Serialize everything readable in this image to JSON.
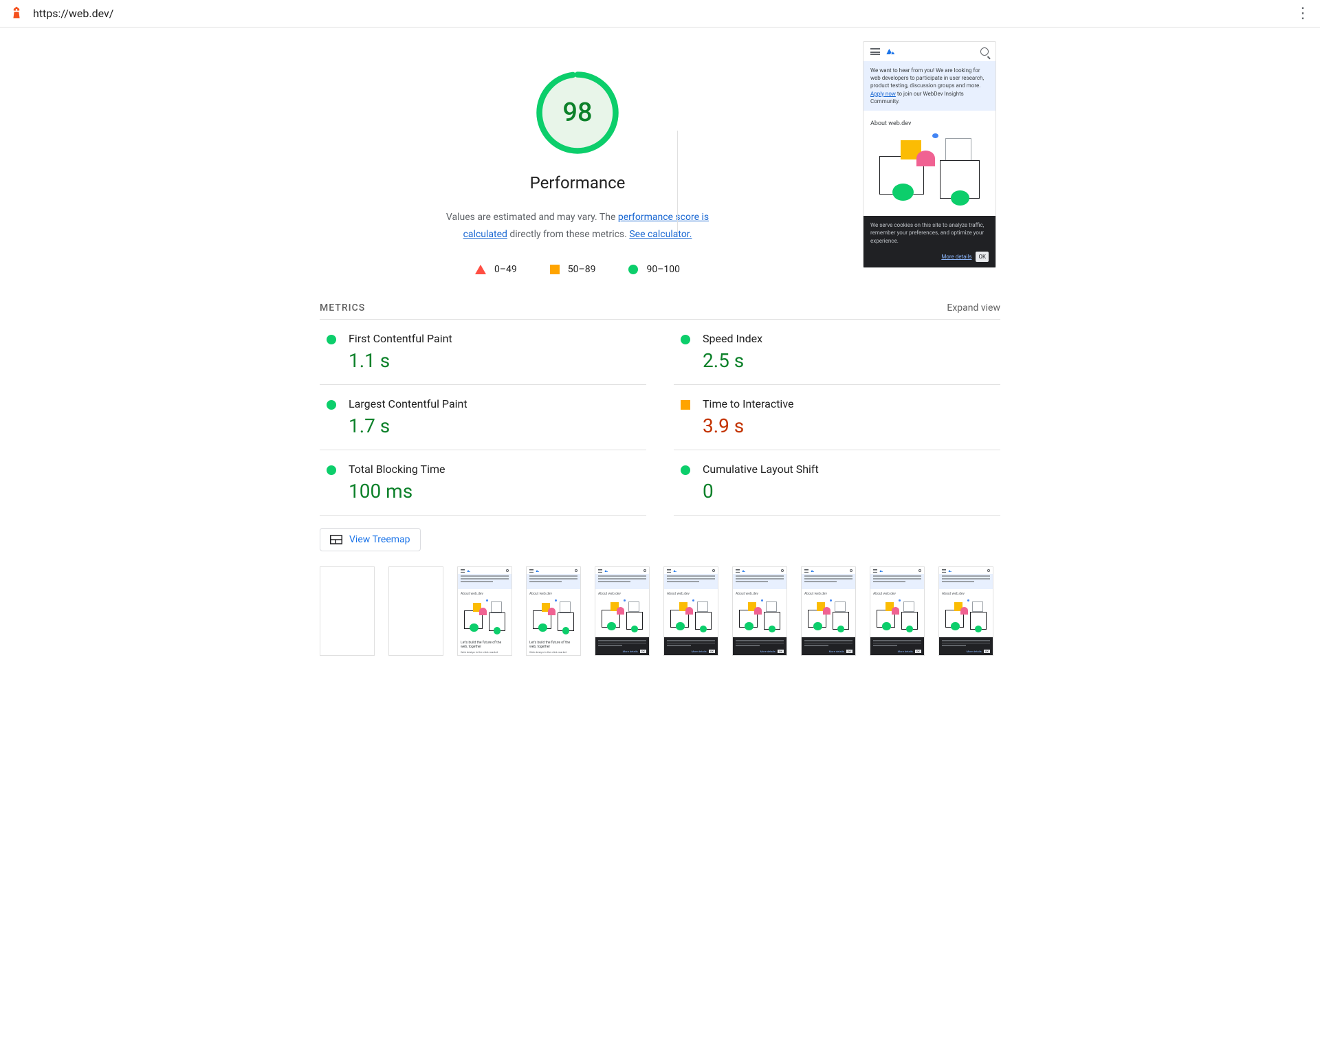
{
  "url": "https://web.dev/",
  "gauge": {
    "score": "98",
    "category": "Performance"
  },
  "desc": {
    "pre": "Values are estimated and may vary. The ",
    "link1": "performance score is calculated",
    "mid": " directly from these metrics. ",
    "link2": "See calculator."
  },
  "legend": {
    "fail": "0–49",
    "avg": "50–89",
    "pass": "90–100"
  },
  "metrics_header": "METRICS",
  "expand": "Expand view",
  "metrics": [
    {
      "name": "First Contentful Paint",
      "value": "1.1 s",
      "status": "green"
    },
    {
      "name": "Speed Index",
      "value": "2.5 s",
      "status": "green"
    },
    {
      "name": "Largest Contentful Paint",
      "value": "1.7 s",
      "status": "green"
    },
    {
      "name": "Time to Interactive",
      "value": "3.9 s",
      "status": "orange"
    },
    {
      "name": "Total Blocking Time",
      "value": "100 ms",
      "status": "green"
    },
    {
      "name": "Cumulative Layout Shift",
      "value": "0",
      "status": "green"
    }
  ],
  "treemap_label": "View Treemap",
  "preview": {
    "banner_pre": "We want to hear from you! We are looking for web developers to participate in user research, product testing, discussion groups and more. ",
    "banner_link": "Apply now",
    "banner_post": " to join our WebDev Insights Community.",
    "about": "About web.dev",
    "cookie": "We serve cookies on this site to analyze traffic, remember your preferences, and optimize your experience.",
    "more": "More details",
    "ok": "OK"
  },
  "thumb": {
    "about": "About web.dev",
    "title": "Let's build the future of the web, together",
    "sub": "Web design in the click market",
    "more": "More details",
    "ok": "OK"
  }
}
